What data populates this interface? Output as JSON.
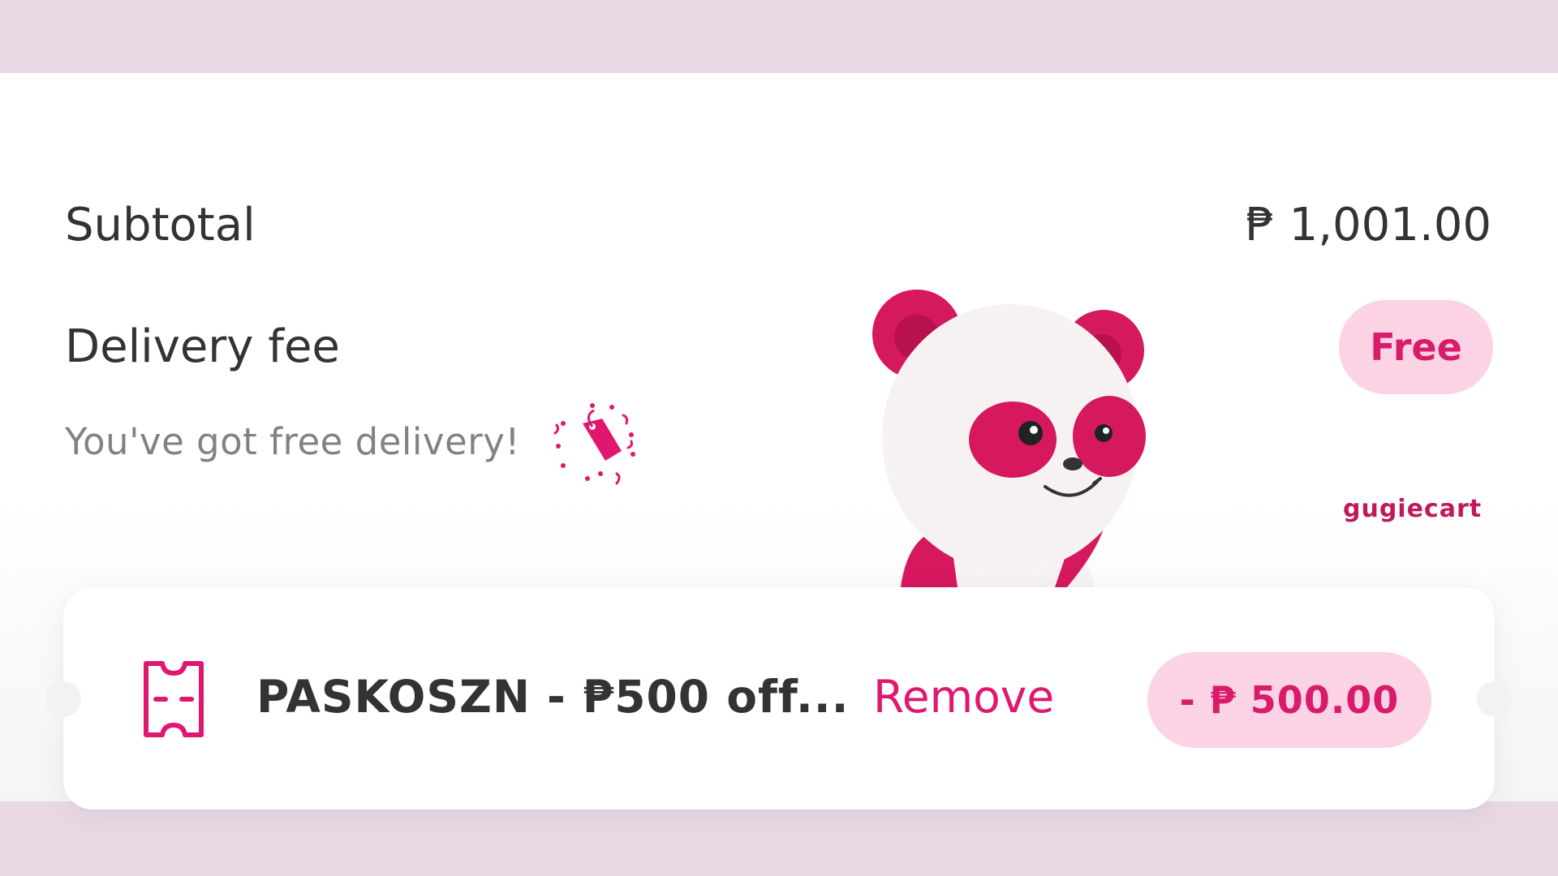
{
  "summary": {
    "subtotal_label": "Subtotal",
    "subtotal_value": "₱ 1,001.00",
    "delivery_label": "Delivery fee",
    "delivery_value": "Free",
    "free_delivery_message": "You've got free delivery!"
  },
  "voucher": {
    "code_text": "PASKOSZN - ₱500 off...",
    "remove_label": "Remove",
    "discount_value": "- ₱ 500.00"
  },
  "watermark": "gugiecart",
  "icons": {
    "tag": "celebration-tag-icon",
    "ticket": "voucher-ticket-icon",
    "mascot": "panda-mascot"
  },
  "colors": {
    "brand_pink": "#e0176e",
    "pill_bg": "#fbd3e5",
    "band_bg": "#ead8e4"
  }
}
